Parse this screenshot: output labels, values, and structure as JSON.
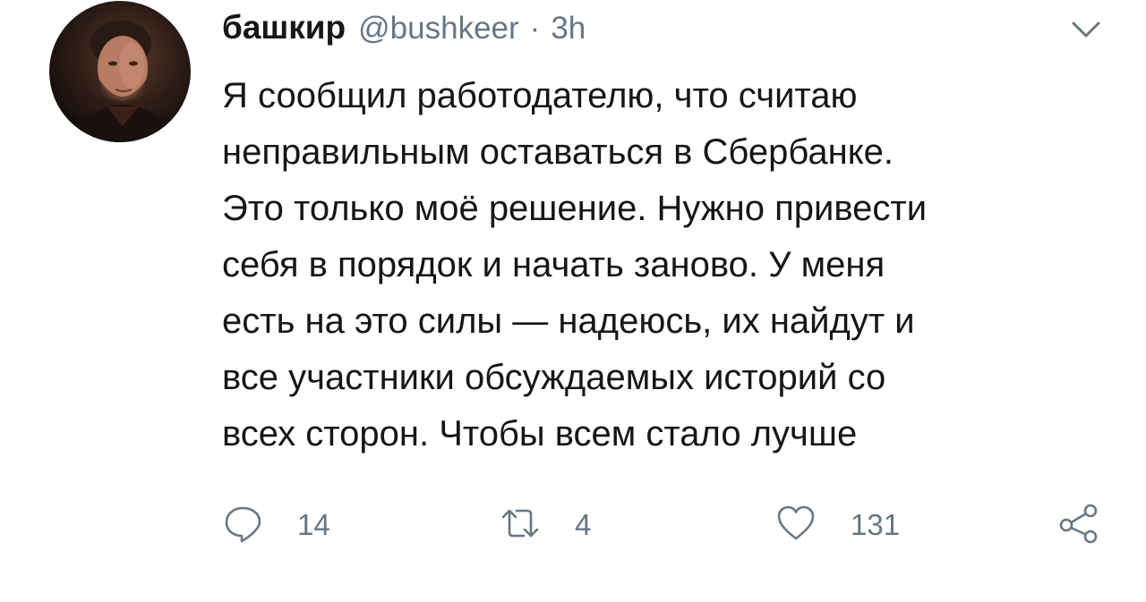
{
  "tweet": {
    "display_name": "башкир",
    "handle": "@bushkeer",
    "separator": "·",
    "time": "3h",
    "text_lines": [
      "Я сообщил работодателю, что считаю",
      "неправильным оставаться в Сбербанке.",
      "Это только моё решение. Нужно привести",
      "себя в порядок и начать заново. У меня",
      "есть на это силы — надеюсь, их найдут и",
      "все участники обсуждаемых историй со",
      "всех сторон. Чтобы всем стало лучше"
    ],
    "actions": {
      "replies": "14",
      "retweets": "4",
      "likes": "131"
    }
  },
  "icons": {
    "avatar": "user-avatar",
    "caret": "chevron-down-icon",
    "reply": "reply-icon",
    "retweet": "retweet-icon",
    "like": "heart-icon",
    "share": "share-icon"
  },
  "colors": {
    "text": "#14171a",
    "secondary": "#657786",
    "background": "#ffffff"
  }
}
